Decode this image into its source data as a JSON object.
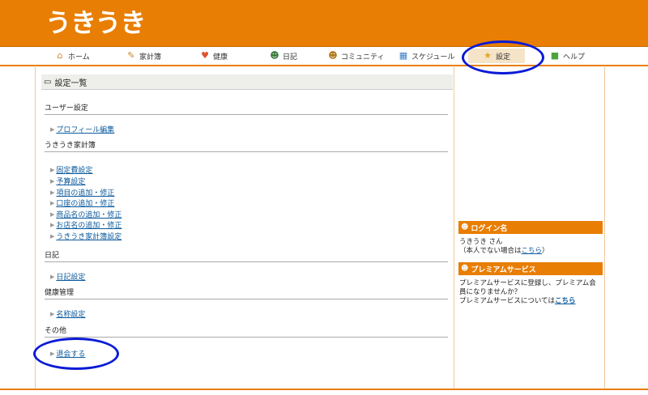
{
  "logo": "うきうき",
  "nav": [
    {
      "label": "ホーム",
      "icon": "house-icon",
      "glyph": "⌂",
      "color": "#d9822b"
    },
    {
      "label": "家計簿",
      "icon": "pencil-icon",
      "glyph": "✎",
      "color": "#c9851e"
    },
    {
      "label": "健康",
      "icon": "heart-icon",
      "glyph": "♥",
      "color": "#e0502a"
    },
    {
      "label": "日記",
      "icon": "person-icon",
      "glyph": "☻",
      "color": "#3a7a3a"
    },
    {
      "label": "コミュニティ",
      "icon": "people-icon",
      "glyph": "☻",
      "color": "#b0781e"
    },
    {
      "label": "スケジュール",
      "icon": "calendar-icon",
      "glyph": "▦",
      "color": "#3a7fc9"
    },
    {
      "label": "設定",
      "icon": "star-icon",
      "glyph": "★",
      "color": "#e2a62a"
    },
    {
      "label": "ヘルプ",
      "icon": "help-icon",
      "glyph": "■",
      "color": "#4ca43c"
    }
  ],
  "main": {
    "title": "設定一覧",
    "title_icon": "book-icon",
    "sections": [
      {
        "heading": "ユーザー設定",
        "links": [
          "プロフィール編集"
        ]
      },
      {
        "heading": "うきうき家計簿",
        "links": [
          "固定費設定",
          "予算設定",
          "項目の追加・修正",
          "口座の追加・修正",
          "商品名の追加・修正",
          "お店名の追加・修正",
          "うきうき家計簿設定"
        ]
      },
      {
        "heading": "日記",
        "links": [
          "日記設定"
        ]
      },
      {
        "heading": "健康管理",
        "links": [
          "名称設定"
        ]
      },
      {
        "heading": "その他",
        "links": [
          "退会する"
        ]
      }
    ]
  },
  "sidebar": {
    "login_header": "ログイン名",
    "login_name": "うきうき さん",
    "login_note_prefix": "（本人でない場合は",
    "login_note_link": "こちら",
    "login_note_suffix": "）",
    "premium_header": "プレミアムサービス",
    "premium_text1": "プレミアムサービスに登録し、プレミアム会",
    "premium_text2": "員になりませんか？",
    "premium_text3": "プレミアムサービスについては",
    "premium_link": "こちら"
  },
  "colors": {
    "brand": "#e87e04",
    "highlight": "#0a1ad6",
    "link": "#0b5a9e"
  }
}
